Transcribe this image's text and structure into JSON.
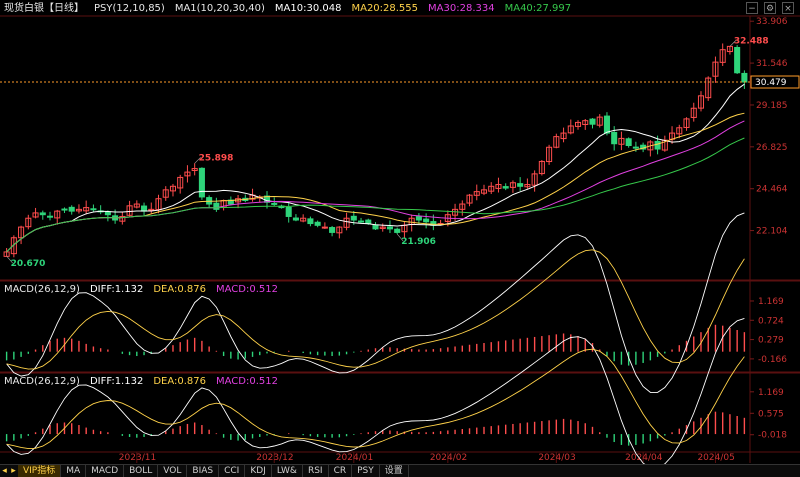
{
  "header": {
    "instrument": "现货白银",
    "period": "【日线】",
    "psy": "PSY(12,10,85)",
    "ma": "MA1(10,20,30,40)",
    "ma10": "MA10:30.048",
    "ma20": "MA20:28.555",
    "ma30": "MA30:28.334",
    "ma40": "MA40:27.997"
  },
  "macd_panels": [
    {
      "name": "MACD(26,12,9)",
      "diff": "DIFF:1.132",
      "dea": "DEA:0.876",
      "macd": "MACD:0.512",
      "ticks": [
        "1.169",
        "0.724",
        "0.279",
        "-0.166"
      ]
    },
    {
      "name": "MACD(26,12,9)",
      "diff": "DIFF:1.132",
      "dea": "DEA:0.876",
      "macd": "MACD:0.512",
      "ticks": [
        "1.169",
        "0.575",
        "-0.018"
      ]
    }
  ],
  "tabs": [
    "VIP指标",
    "MA",
    "MACD",
    "BOLL",
    "VOL",
    "BIAS",
    "CCI",
    "KDJ",
    "LW&",
    "RSI",
    "CR",
    "PSY",
    "设置"
  ],
  "colors": {
    "up": "#ff4d4d",
    "down": "#2ed47a",
    "ma10": "#ffffff",
    "ma20": "#ffd24a",
    "ma30": "#e040e0",
    "ma40": "#36c84b",
    "axis_text": "#c33",
    "current": "#ff9c2a"
  },
  "chart_data": {
    "type": "candlestick",
    "y_ticks": [
      33.906,
      31.546,
      29.185,
      26.825,
      24.464,
      22.104
    ],
    "ylim": [
      19.6,
      34.2
    ],
    "current_price": 30.479,
    "x_tick_labels": [
      "2023/11",
      "2023/12",
      "2024/01",
      "2024/02",
      "2024/03",
      "2024/04",
      "2024/05"
    ],
    "annotations": [
      {
        "label": "32.488",
        "value": 32.488
      },
      {
        "label": "25.898",
        "value": 25.898
      },
      {
        "label": "21.906",
        "value": 21.906
      },
      {
        "label": "20.670",
        "value": 20.67
      }
    ],
    "close_profile": [
      20.9,
      21.7,
      22.3,
      22.8,
      23.1,
      23.0,
      22.9,
      23.2,
      23.3,
      23.2,
      23.3,
      23.4,
      23.3,
      23.2,
      23.0,
      22.7,
      22.9,
      23.5,
      23.6,
      23.2,
      23.3,
      23.9,
      24.4,
      24.6,
      25.1,
      25.4,
      25.6,
      24.0,
      23.6,
      23.3,
      23.8,
      23.6,
      23.9,
      23.8,
      24.1,
      24.0,
      23.7,
      23.6,
      23.4,
      22.9,
      22.7,
      22.8,
      22.5,
      22.4,
      22.3,
      22.0,
      22.3,
      22.8,
      22.7,
      22.6,
      22.5,
      22.2,
      22.3,
      22.2,
      22.0,
      22.4,
      22.8,
      22.7,
      22.6,
      22.4,
      22.5,
      23.0,
      23.3,
      23.6,
      24.1,
      24.3,
      24.4,
      24.6,
      24.7,
      24.5,
      24.8,
      24.6,
      24.7,
      25.3,
      26.0,
      26.8,
      27.4,
      27.6,
      28.0,
      28.2,
      28.3,
      28.1,
      28.5,
      27.6,
      27.0,
      27.3,
      26.9,
      26.8,
      26.7,
      27.1,
      26.7,
      27.2,
      27.6,
      27.9,
      28.4,
      29.0,
      29.7,
      30.7,
      31.6,
      32.3,
      32.488,
      31.0,
      30.479
    ],
    "macd_histogram": [
      -0.2,
      -0.18,
      -0.12,
      -0.05,
      0.05,
      0.15,
      0.25,
      0.3,
      0.32,
      0.3,
      0.25,
      0.18,
      0.12,
      0.08,
      0.05,
      0.0,
      -0.05,
      -0.08,
      -0.1,
      -0.08,
      -0.05,
      0.0,
      0.08,
      0.15,
      0.22,
      0.28,
      0.32,
      0.25,
      0.12,
      0.02,
      -0.1,
      -0.16,
      -0.18,
      -0.16,
      -0.12,
      -0.08,
      -0.04,
      -0.02,
      0.0,
      0.02,
      0.0,
      -0.03,
      -0.06,
      -0.08,
      -0.09,
      -0.1,
      -0.09,
      -0.06,
      -0.02,
      0.02,
      0.05,
      0.08,
      0.1,
      0.1,
      0.08,
      0.07,
      0.06,
      0.05,
      0.05,
      0.06,
      0.08,
      0.1,
      0.12,
      0.14,
      0.16,
      0.18,
      0.2,
      0.22,
      0.24,
      0.26,
      0.28,
      0.3,
      0.32,
      0.34,
      0.36,
      0.38,
      0.4,
      0.42,
      0.4,
      0.36,
      0.3,
      0.2,
      0.05,
      -0.1,
      -0.22,
      -0.3,
      -0.32,
      -0.3,
      -0.26,
      -0.2,
      -0.12,
      -0.04,
      0.05,
      0.15,
      0.25,
      0.35,
      0.45,
      0.55,
      0.62,
      0.6,
      0.55,
      0.5,
      0.45
    ]
  }
}
